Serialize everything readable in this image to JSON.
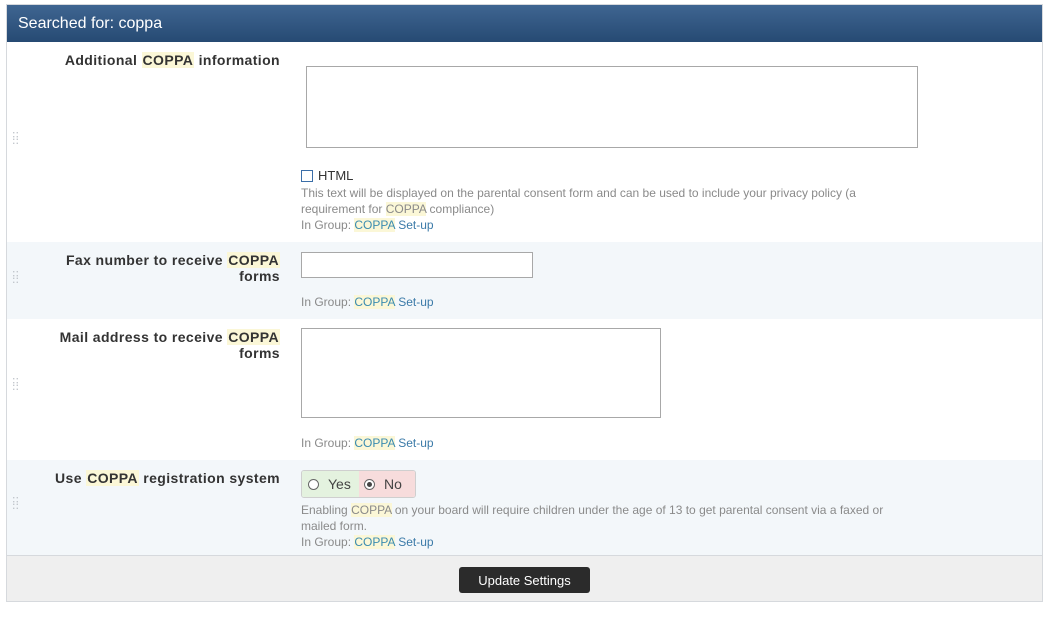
{
  "header": {
    "title": "Searched for: coppa"
  },
  "settings": [
    {
      "label_pre": "Additional",
      "label_hl": "COPPA",
      "label_post": "information",
      "checkbox_label": "HTML",
      "desc_pre": "This text will be displayed on the parental consent form and can be used to include your privacy policy (a requirement for",
      "desc_hl": "COPPA",
      "desc_post": "compliance)",
      "group_prefix": "In Group:",
      "group_hl": "COPPA",
      "group_link": "Set-up"
    },
    {
      "label_pre": "Fax number to receive",
      "label_hl": "COPPA",
      "label_post": "forms",
      "input_value": "",
      "group_prefix": "In Group:",
      "group_hl": "COPPA",
      "group_link": "Set-up"
    },
    {
      "label_pre": "Mail address to receive",
      "label_hl": "COPPA",
      "label_post": "forms",
      "group_prefix": "In Group:",
      "group_hl": "COPPA",
      "group_link": "Set-up"
    },
    {
      "label_pre": "Use",
      "label_hl": "COPPA",
      "label_post": "registration system",
      "yes_label": "Yes",
      "no_label": "No",
      "selected": "No",
      "desc_pre": "Enabling",
      "desc_hl": "COPPA",
      "desc_post": "on your board will require children under the age of 13 to get parental consent via a faxed or mailed form.",
      "group_prefix": "In Group:",
      "group_hl": "COPPA",
      "group_link": "Set-up"
    }
  ],
  "footer": {
    "submit_label": "Update Settings"
  },
  "colors": {
    "header": "#2f5580",
    "alt_row": "#f3f7fa",
    "highlight": "#fbf7d7",
    "yes_bg": "#e4f2df",
    "no_bg": "#f7dcdc"
  },
  "icons": [
    "drag-handle-icon",
    "checkbox-icon",
    "radio-icon"
  ]
}
